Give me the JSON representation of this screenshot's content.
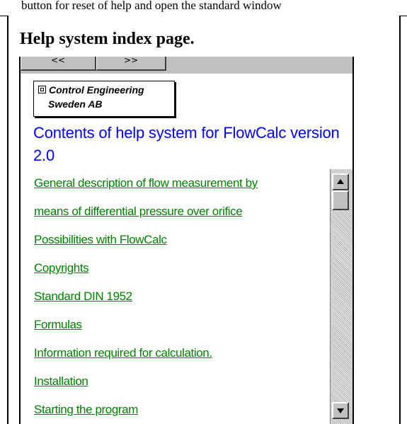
{
  "top_line": "button for reset of help and open the standard window",
  "caption": "Help system index page.",
  "nav": {
    "back_glyph": "<<",
    "forward_glyph": ">>"
  },
  "logo": {
    "line1": "Control Engineering",
    "line2": "Sweden AB"
  },
  "title": "Contents of help system for FlowCalc version 2.0",
  "links": [
    "General description of flow measurement by",
    "means of differential pressure over orifice",
    "Possibilities with FlowCalc",
    "Copyrights",
    "Standard DIN 1952",
    "Formulas",
    "Information required for calculation.",
    "Installation",
    "Starting the program"
  ],
  "colors": {
    "title": "#0000ff",
    "link": "#008000",
    "chrome": "#c0c0c0"
  },
  "icons": {
    "scroll_up": "scroll-up-arrow-icon",
    "scroll_down": "scroll-down-arrow-icon",
    "logo_mark": "company-logo-mark-icon"
  }
}
